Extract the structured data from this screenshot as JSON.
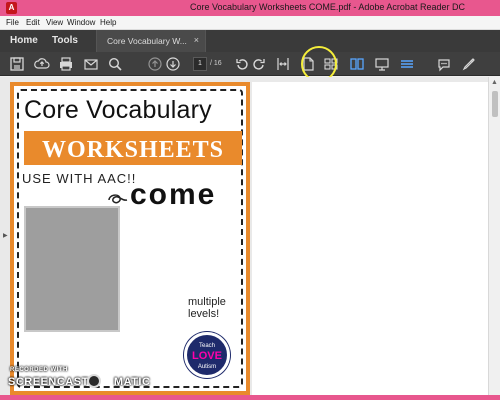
{
  "window": {
    "title": "Core Vocabulary Worksheets COME.pdf - Adobe Acrobat Reader DC",
    "app_icon": "acrobat-icon"
  },
  "menu": {
    "items": [
      "File",
      "Edit",
      "View",
      "Window",
      "Help"
    ]
  },
  "tabs": {
    "home": "Home",
    "tools": "Tools",
    "document": "Core Vocabulary W...",
    "close": "×"
  },
  "toolbar": {
    "current_page": "1",
    "total_pages": "/ 16",
    "icons": [
      "save-icon",
      "upload-icon",
      "print-icon",
      "email-icon",
      "search-icon",
      "prev-page-icon",
      "next-page-icon",
      "rotate-ccw-icon",
      "rotate-cw-icon",
      "fit-width-icon",
      "single-page-icon",
      "two-page-icon",
      "two-page-scroll-icon",
      "present-icon",
      "read-mode-icon",
      "comment-icon",
      "sign-icon"
    ],
    "accent": "#58a6ff"
  },
  "document": {
    "title": "Core Vocabulary",
    "banner": "WORKSHEETS",
    "subtitle": "USE WITH AAC!!",
    "word": "come",
    "levels_line1": "multiple",
    "levels_line2": "levels!",
    "badge_top": "Teach",
    "badge_mid": "LOVE",
    "badge_bottom": "Autism",
    "accent": "#e98a2c"
  },
  "watermark": {
    "recorded": "RECORDED WITH",
    "brand_left": "SCREENCAST",
    "brand_right": "MATIC"
  }
}
